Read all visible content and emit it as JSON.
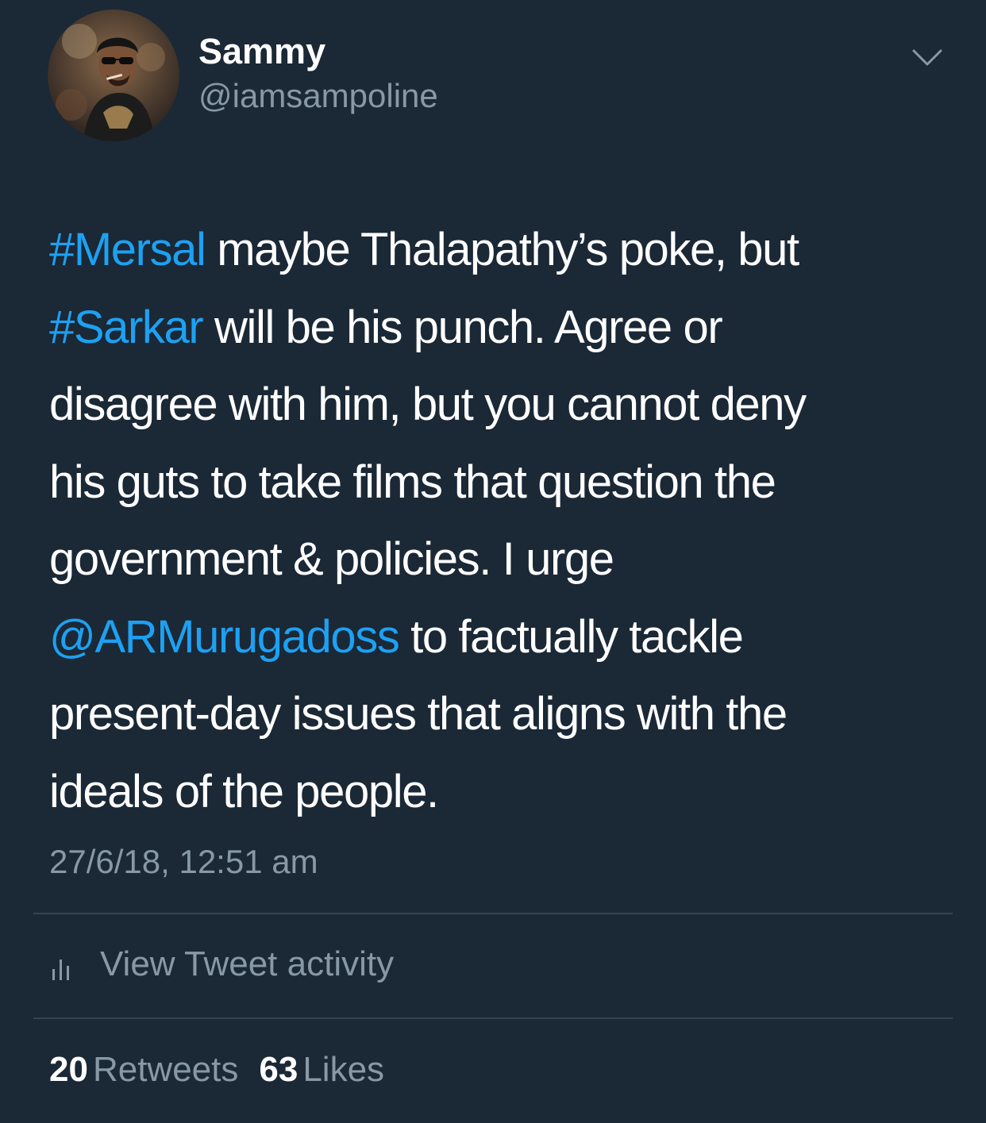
{
  "user": {
    "display_name": "Sammy",
    "handle": "@iamsampoline",
    "avatar_icon": "profile-photo"
  },
  "tweet": {
    "lines": [
      [
        {
          "text": "#Mersal",
          "type": "hashtag"
        },
        {
          "text": " maybe Thalapathy’s poke, but",
          "type": "text"
        }
      ],
      [
        {
          "text": "#Sarkar",
          "type": "hashtag"
        },
        {
          "text": " will be his punch. Agree or",
          "type": "text"
        }
      ],
      [
        {
          "text": "disagree with him, but you cannot deny",
          "type": "text"
        }
      ],
      [
        {
          "text": "his guts to take films that question the",
          "type": "text"
        }
      ],
      [
        {
          "text": "government & policies. I urge",
          "type": "text"
        }
      ],
      [
        {
          "text": "@ARMurugadoss",
          "type": "mention"
        },
        {
          "text": " to factually tackle",
          "type": "text"
        }
      ],
      [
        {
          "text": "present-day issues that aligns with the",
          "type": "text"
        }
      ],
      [
        {
          "text": "ideals of the people.",
          "type": "text"
        }
      ]
    ],
    "timestamp": "27/6/18, 12:51 am"
  },
  "activity": {
    "icon": "bar-chart-icon",
    "label": "View Tweet activity"
  },
  "stats": {
    "retweets_count": "20",
    "retweets_label": "Retweets",
    "likes_count": "63",
    "likes_label": "Likes"
  },
  "colors": {
    "background": "#1b2836",
    "link": "#1da1f2",
    "secondary_text": "#8899a6",
    "divider": "#38444d"
  },
  "icons": {
    "menu": "chevron-down-icon"
  }
}
